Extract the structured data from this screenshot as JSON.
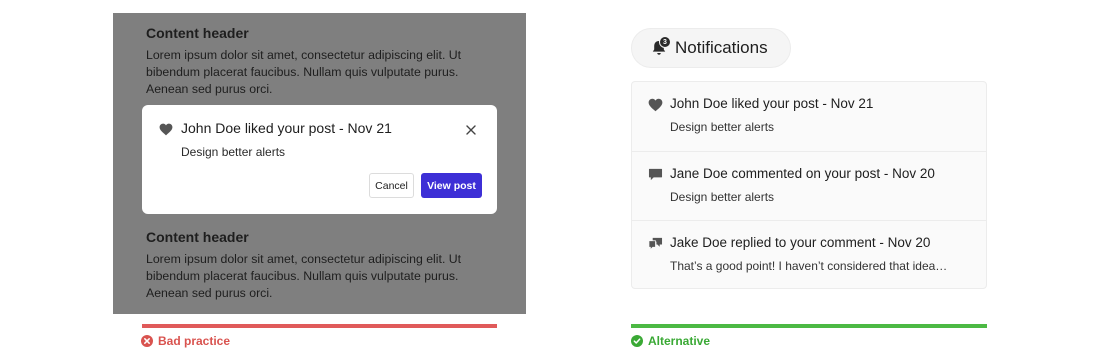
{
  "bad_example": {
    "content_blocks": [
      {
        "header": "Content header",
        "body": "Lorem ipsum dolor sit amet, consectetur adipiscing elit. Ut bibendum placerat faucibus. Nullam quis vulputate purus. Aenean sed purus orci."
      },
      {
        "header": "Content header",
        "body": "Lorem ipsum dolor sit amet, consectetur adipiscing elit. Ut bibendum placerat faucibus. Nullam quis vulputate purus. Aenean sed purus orci."
      }
    ],
    "modal": {
      "icon": "heart-icon",
      "title": "John Doe liked your post - Nov 21",
      "subtitle": "Design better alerts",
      "cancel_label": "Cancel",
      "view_label": "View post"
    },
    "label": "Bad practice",
    "color": "#e05a5a"
  },
  "good_example": {
    "header": {
      "title": "Notifications",
      "badge": "3",
      "icon": "bell-icon"
    },
    "notifications": [
      {
        "icon": "heart-icon",
        "title": "John Doe liked your post - Nov 21",
        "subtitle": "Design better alerts"
      },
      {
        "icon": "comment-icon",
        "title": "Jane Doe commented on your post - Nov 20",
        "subtitle": "Design better alerts"
      },
      {
        "icon": "reply-icon",
        "title": "Jake Doe replied to your comment - Nov 20",
        "subtitle": "That’s a good point! I haven’t considered that idea…"
      }
    ],
    "label": "Alternative",
    "color": "#4cb944"
  },
  "colors": {
    "overlay": "#7f7f7f",
    "primary_button": "#3d2fd6"
  }
}
